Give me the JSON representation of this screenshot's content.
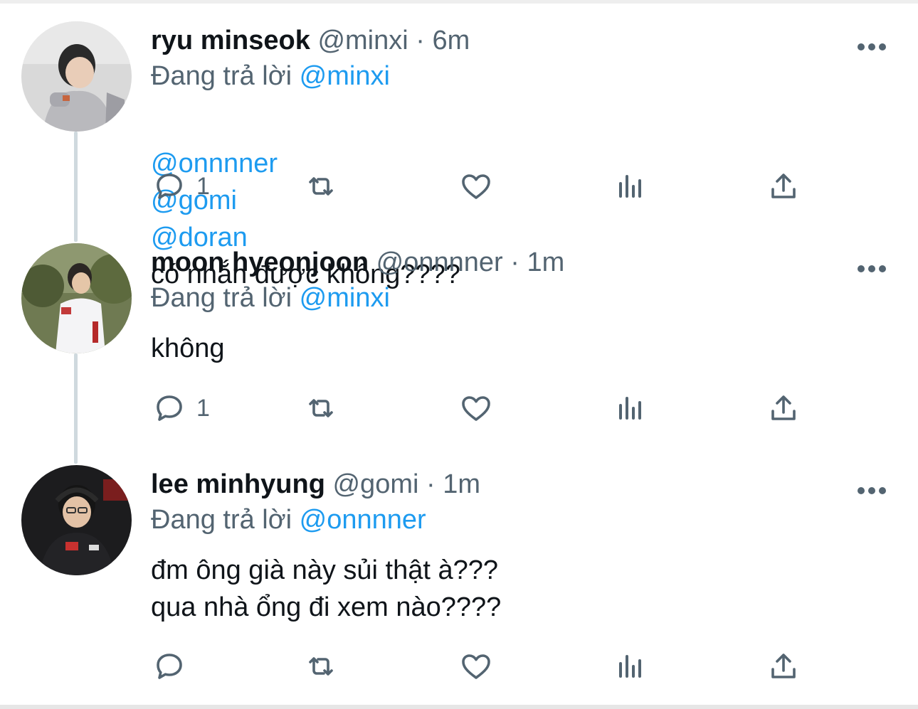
{
  "colors": {
    "accent": "#1d9bf0",
    "muted": "#536471",
    "text": "#0f1419",
    "thread_line": "#cfd9de"
  },
  "tweets": [
    {
      "name": "ryu minseok",
      "handle": "@minxi",
      "separator": "·",
      "time": "6m",
      "reply_prefix": "Đang trả lời",
      "reply_to": "@minxi",
      "body_mentions": [
        "@onnnner",
        "@gomi",
        "@doran"
      ],
      "body": "có nhắn được không????",
      "reply_count": "1",
      "avatar_icon": "avatar-photo"
    },
    {
      "name": "moon hyeonjoon",
      "handle": "@onnnner",
      "separator": "·",
      "time": "1m",
      "reply_prefix": "Đang trả lời",
      "reply_to": "@minxi",
      "body": "không",
      "reply_count": "1",
      "avatar_icon": "avatar-photo"
    },
    {
      "name": "lee minhyung",
      "handle": "@gomi",
      "separator": "·",
      "time": "1m",
      "reply_prefix": "Đang trả lời",
      "reply_to": "@onnnner",
      "body": "đm ông già này sủi thật à???\nqua nhà ổng đi xem nào????",
      "reply_count": "",
      "avatar_icon": "avatar-photo"
    }
  ],
  "action_icons": [
    "reply-icon",
    "retweet-icon",
    "like-icon",
    "analytics-icon",
    "share-icon"
  ]
}
